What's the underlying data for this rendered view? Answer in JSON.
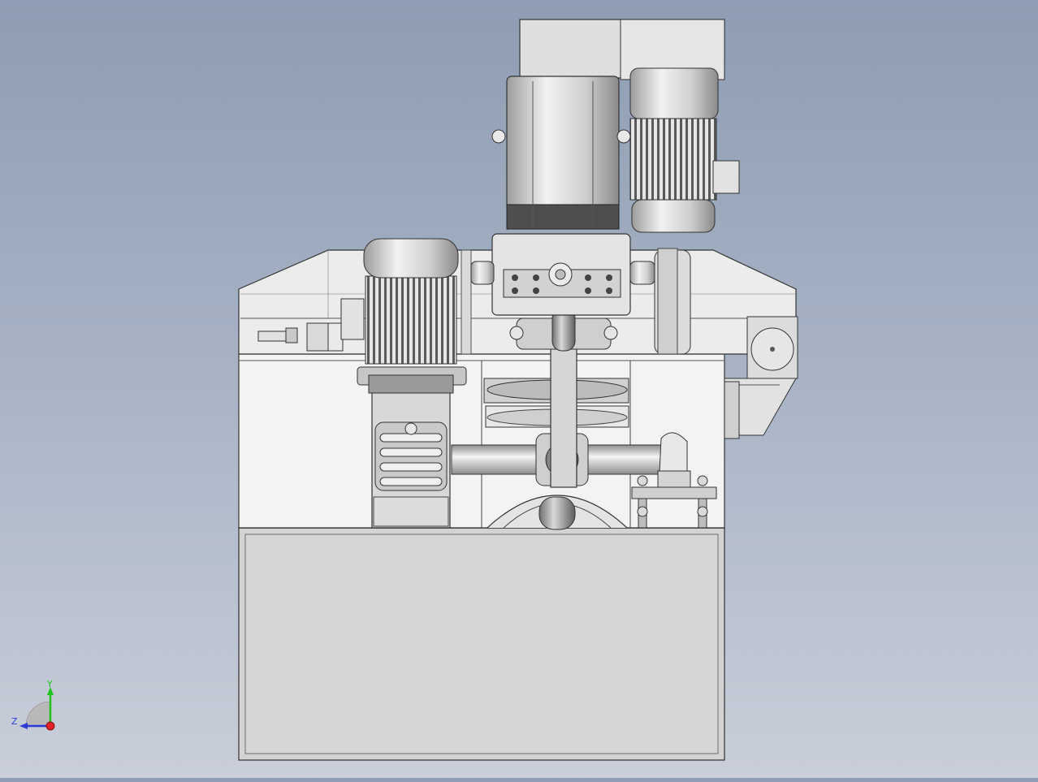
{
  "viewport": {
    "background_top": "#8e9db3",
    "background_bottom": "#c9ced9"
  },
  "triad": {
    "x_label": "",
    "y_label": "Y",
    "z_label": "Z",
    "y_color": "#1fc21f",
    "z_color": "#2b3bd6",
    "origin_color": "#e0202a"
  },
  "parts": [
    "base-cabinet",
    "upper-frame",
    "drive-motor-left",
    "worm-gearbox",
    "gear-motor-top",
    "gearbox-housing",
    "crank-arm",
    "drive-shaft",
    "eccentric-wheel",
    "side-motor-right",
    "bearing-support"
  ]
}
